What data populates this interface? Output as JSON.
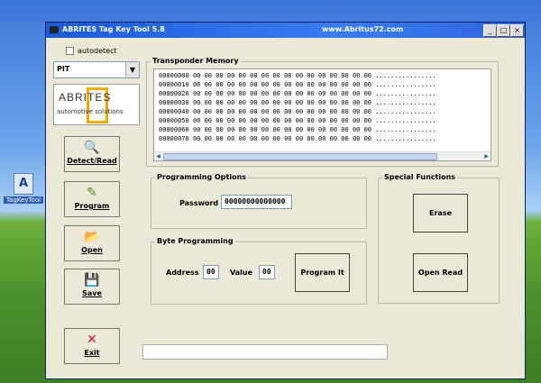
{
  "desktop": {
    "icon_label": "TagKeyTool",
    "icon_glyph": "A"
  },
  "window": {
    "title": "ABRITES Tag Key Tool 5.8",
    "url": "www.Abritus72.com",
    "min": "_",
    "max": "□",
    "close": "×"
  },
  "left": {
    "autodetect_label": "autodetect",
    "transponder_type": "PIT",
    "logo_brand": "ABRITES",
    "logo_tagline": "automotive solutions",
    "buttons": [
      {
        "label": "Detect/Read",
        "icon": "magnifier-icon"
      },
      {
        "label": "Program",
        "icon": "pen-icon"
      },
      {
        "label": "Open",
        "icon": "folder-icon"
      },
      {
        "label": "Save",
        "icon": "floppy-icon"
      },
      {
        "label": "Exit",
        "icon": "x-icon"
      }
    ]
  },
  "memory": {
    "title": "Transponder Memory",
    "rows": [
      {
        "addr": "00000000",
        "hex": "00 00 00 00 00 00 00 00 00 00 00 00 00 00 00 00",
        "ascii": "................"
      },
      {
        "addr": "00000010",
        "hex": "00 00 00 00 00 00 00 00 00 00 00 00 00 00 00 00",
        "ascii": "................"
      },
      {
        "addr": "00000020",
        "hex": "00 00 00 00 00 00 00 00 00 00 00 00 00 00 00 00",
        "ascii": "................"
      },
      {
        "addr": "00000030",
        "hex": "00 00 00 00 00 00 00 00 00 00 00 00 00 00 00 00",
        "ascii": "................"
      },
      {
        "addr": "00000040",
        "hex": "00 00 00 00 00 00 00 00 00 00 00 00 00 00 00 00",
        "ascii": "................"
      },
      {
        "addr": "00000050",
        "hex": "00 00 00 00 00 00 00 00 00 00 00 00 00 00 00 00",
        "ascii": "................"
      },
      {
        "addr": "00000060",
        "hex": "00 00 00 00 00 00 00 00 00 00 00 00 00 00 00 00",
        "ascii": "................"
      },
      {
        "addr": "00000070",
        "hex": "00 00 00 00 00 00 00 00 00 00 00 00 00 00 00 00",
        "ascii": "................"
      }
    ]
  },
  "programming_options": {
    "title": "Programming Options",
    "password_label": "Password",
    "password_value": "00000000000000"
  },
  "byte_programming": {
    "title": "Byte Programming",
    "address_label": "Address",
    "address_value": "00",
    "value_label": "Value",
    "value_value": "00",
    "program_button": "Program It"
  },
  "special_functions": {
    "title": "Special Functions",
    "erase_button": "Erase",
    "open_read_button": "Open Read"
  }
}
